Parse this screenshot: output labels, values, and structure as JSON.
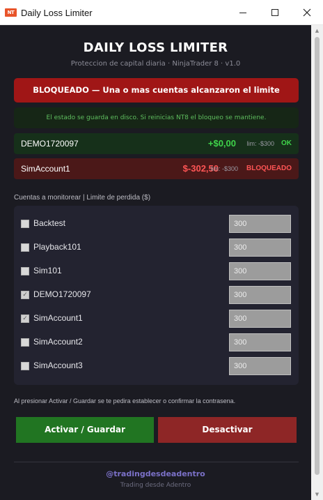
{
  "window": {
    "icon_text": "NT",
    "title": "Daily Loss Limiter",
    "minimize_icon": "minimize-icon",
    "maximize_icon": "maximize-icon",
    "close_icon": "close-icon"
  },
  "header": {
    "title": "DAILY LOSS LIMITER",
    "subtitle": "Proteccion de capital diaria · NinjaTrader 8 · v1.0"
  },
  "alert": {
    "text": "BLOQUEADO — Una o mas cuentas alcanzaron el limite",
    "color": "#a01616"
  },
  "note": {
    "text": "El estado se guarda en disco. Si reinicias NT8 el bloqueo se mantiene.",
    "color": "#5fbf5f"
  },
  "accounts": [
    {
      "name": "DEMO1720097",
      "pnl": "+$0,00",
      "limit": "lim: -$300",
      "status": "OK",
      "color": "#3fd34a"
    },
    {
      "name": "SimAccount1",
      "pnl": "$-302,50",
      "limit": "lim: -$300",
      "status": "BLOQUEADO",
      "color": "#ff5555"
    }
  ],
  "monitor": {
    "label": "Cuentas a monitorear  |  Limite de perdida ($)",
    "rows": [
      {
        "name": "Backtest",
        "checked": false,
        "limit": "300"
      },
      {
        "name": "Playback101",
        "checked": false,
        "limit": "300"
      },
      {
        "name": "Sim101",
        "checked": false,
        "limit": "300"
      },
      {
        "name": "DEMO1720097",
        "checked": true,
        "limit": "300"
      },
      {
        "name": "SimAccount1",
        "checked": true,
        "limit": "300"
      },
      {
        "name": "SimAccount2",
        "checked": false,
        "limit": "300"
      },
      {
        "name": "SimAccount3",
        "checked": false,
        "limit": "300"
      }
    ]
  },
  "hint": "Al presionar Activar / Guardar se te pedira establecer o confirmar la contrasena.",
  "buttons": {
    "activate": "Activar / Guardar",
    "deactivate": "Desactivar"
  },
  "footer": {
    "handle": "@tradingdesdeadentro",
    "tagline": "Trading desde Adentro"
  }
}
